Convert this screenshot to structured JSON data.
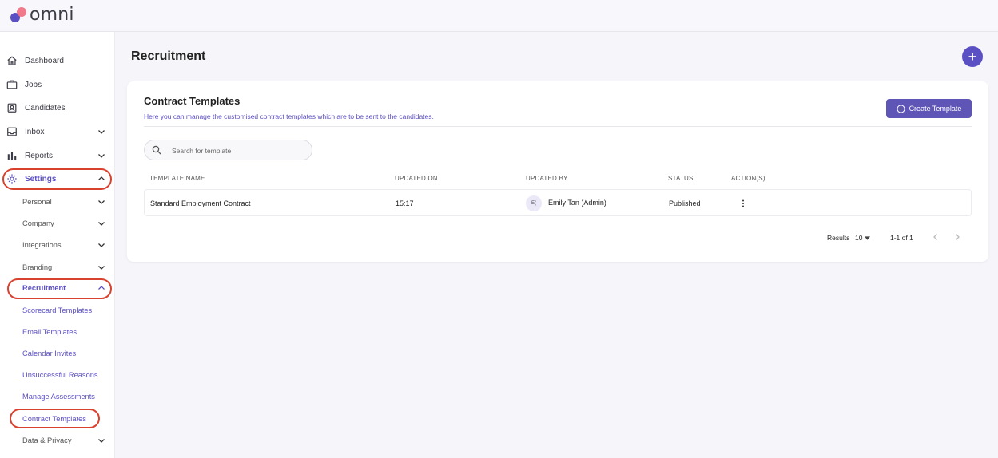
{
  "app": {
    "logo_text": "omni"
  },
  "sidebar": {
    "items": [
      {
        "label": "Dashboard",
        "icon": "home-icon"
      },
      {
        "label": "Jobs",
        "icon": "briefcase-icon"
      },
      {
        "label": "Candidates",
        "icon": "id-badge-icon"
      },
      {
        "label": "Inbox",
        "icon": "inbox-icon"
      },
      {
        "label": "Reports",
        "icon": "bar-chart-icon"
      },
      {
        "label": "Settings",
        "icon": "gear-icon"
      }
    ],
    "settings_sub": {
      "personal": "Personal",
      "company": "Company",
      "integrations": "Integrations",
      "branding": "Branding",
      "recruitment": "Recruitment",
      "data_privacy": "Data & Privacy"
    },
    "recruitment_sub": [
      "Scorecard Templates",
      "Email Templates",
      "Calendar Invites",
      "Unsuccessful Reasons",
      "Manage Assessments",
      "Contract Templates"
    ]
  },
  "main": {
    "title": "Recruitment",
    "card": {
      "title": "Contract Templates",
      "description": "Here you can manage the customised contract templates which are to be sent to the candidates.",
      "create_label": "Create Template",
      "search_placeholder": "Search for template",
      "columns": [
        "TEMPLATE NAME",
        "UPDATED ON",
        "UPDATED BY",
        "STATUS",
        "ACTION(S)"
      ],
      "rows": [
        {
          "name": "Standard Employment Contract",
          "updated_on": "15:17",
          "avatar_initials": "E(",
          "updated_by": "Emily Tan (Admin)",
          "status": "Published"
        }
      ],
      "pagination": {
        "results_label": "Results",
        "page_size": "10",
        "range": "1-1 of 1"
      }
    }
  },
  "colors": {
    "accent": "#5b4fc4",
    "highlight": "#d9412f",
    "logo_pink": "#f06a80"
  }
}
